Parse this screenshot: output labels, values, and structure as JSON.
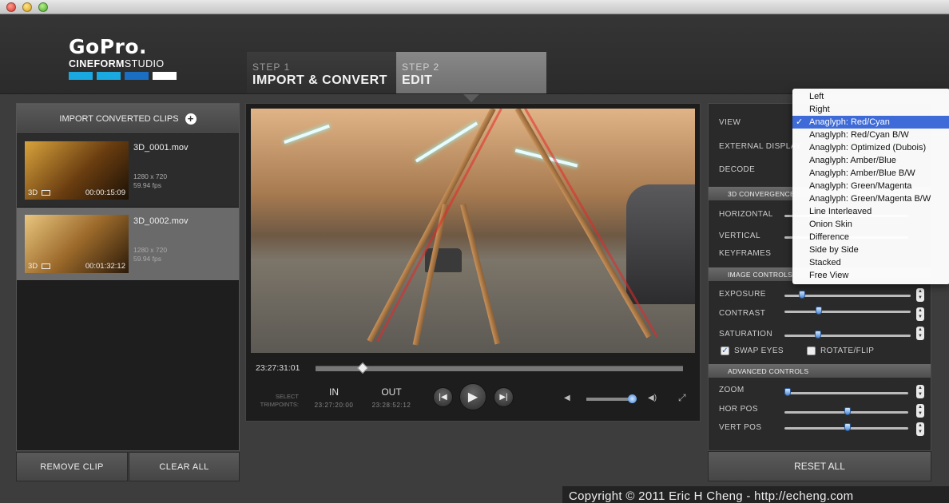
{
  "window": {
    "title": ""
  },
  "logo": {
    "main": "GoPro.",
    "sub_bold": "CINEFORM",
    "sub_light": "STUDIO",
    "bar_colors": [
      "#19a8e0",
      "#19a8e0",
      "#1b6fc2",
      "#ffffff"
    ]
  },
  "steps": [
    {
      "label": "STEP 1",
      "title": "IMPORT & CONVERT",
      "active": false
    },
    {
      "label": "STEP 2",
      "title": "EDIT",
      "active": true
    }
  ],
  "clips_panel": {
    "import_label": "IMPORT CONVERTED CLIPS",
    "clips": [
      {
        "name": "3D_0001.mov",
        "resolution": "1280 x 720",
        "fps": "59.94 fps",
        "badge": "3D",
        "duration": "00:00:15:09",
        "selected": false
      },
      {
        "name": "3D_0002.mov",
        "resolution": "1280 x 720",
        "fps": "59.94 fps",
        "badge": "3D",
        "duration": "00:01:32:12",
        "selected": true
      }
    ],
    "remove_label": "REMOVE CLIP",
    "clear_label": "CLEAR ALL"
  },
  "player": {
    "timecode": "23:27:31:01",
    "scrub_position": 0.12,
    "select_trimpoints": "SELECT\nTRIMPOINTS:",
    "in_label": "IN",
    "in_value": "23:27:20:00",
    "out_label": "OUT",
    "out_value": "23:28:52:12",
    "volume": 0.9
  },
  "controls": {
    "view_label": "VIEW",
    "external_display_label": "EXTERNAL DISPLAY",
    "decode_label": "DECODE",
    "convergence_section": "3D CONVERGENCE",
    "horizontal_label": "HORIZONTAL",
    "vertical_label": "VERTICAL",
    "keyframes_label": "KEYFRAMES",
    "image_section": "IMAGE CONTROLS",
    "exposure_label": "EXPOSURE",
    "exposure": 0.12,
    "contrast_label": "CONTRAST",
    "contrast": 0.26,
    "saturation_label": "SATURATION",
    "saturation": 0.25,
    "swap_eyes_label": "SWAP EYES",
    "swap_eyes": true,
    "rotate_flip_label": "ROTATE/FLIP",
    "rotate_flip": false,
    "advanced_section": "ADVANCED CONTROLS",
    "zoom_label": "ZOOM",
    "zoom": 0.0,
    "hor_pos_label": "HOR POS",
    "hor_pos": 0.5,
    "vert_pos_label": "VERT POS",
    "vert_pos": 0.5,
    "reset_label": "RESET ALL"
  },
  "view_menu": {
    "check_glyph": "✓",
    "items": [
      "Left",
      "Right",
      "Anaglyph: Red/Cyan",
      "Anaglyph: Red/Cyan B/W",
      "Anaglyph: Optimized (Dubois)",
      "Anaglyph: Amber/Blue",
      "Anaglyph: Amber/Blue B/W",
      "Anaglyph: Green/Magenta",
      "Anaglyph: Green/Magenta B/W",
      "Line Interleaved",
      "Onion Skin",
      "Difference",
      "Side by Side",
      "Stacked",
      "Free View"
    ],
    "selected_index": 2,
    "highlight_color": "#3e6bd8"
  },
  "copyright": "Copyright © 2011 Eric H Cheng - http://echeng.com"
}
